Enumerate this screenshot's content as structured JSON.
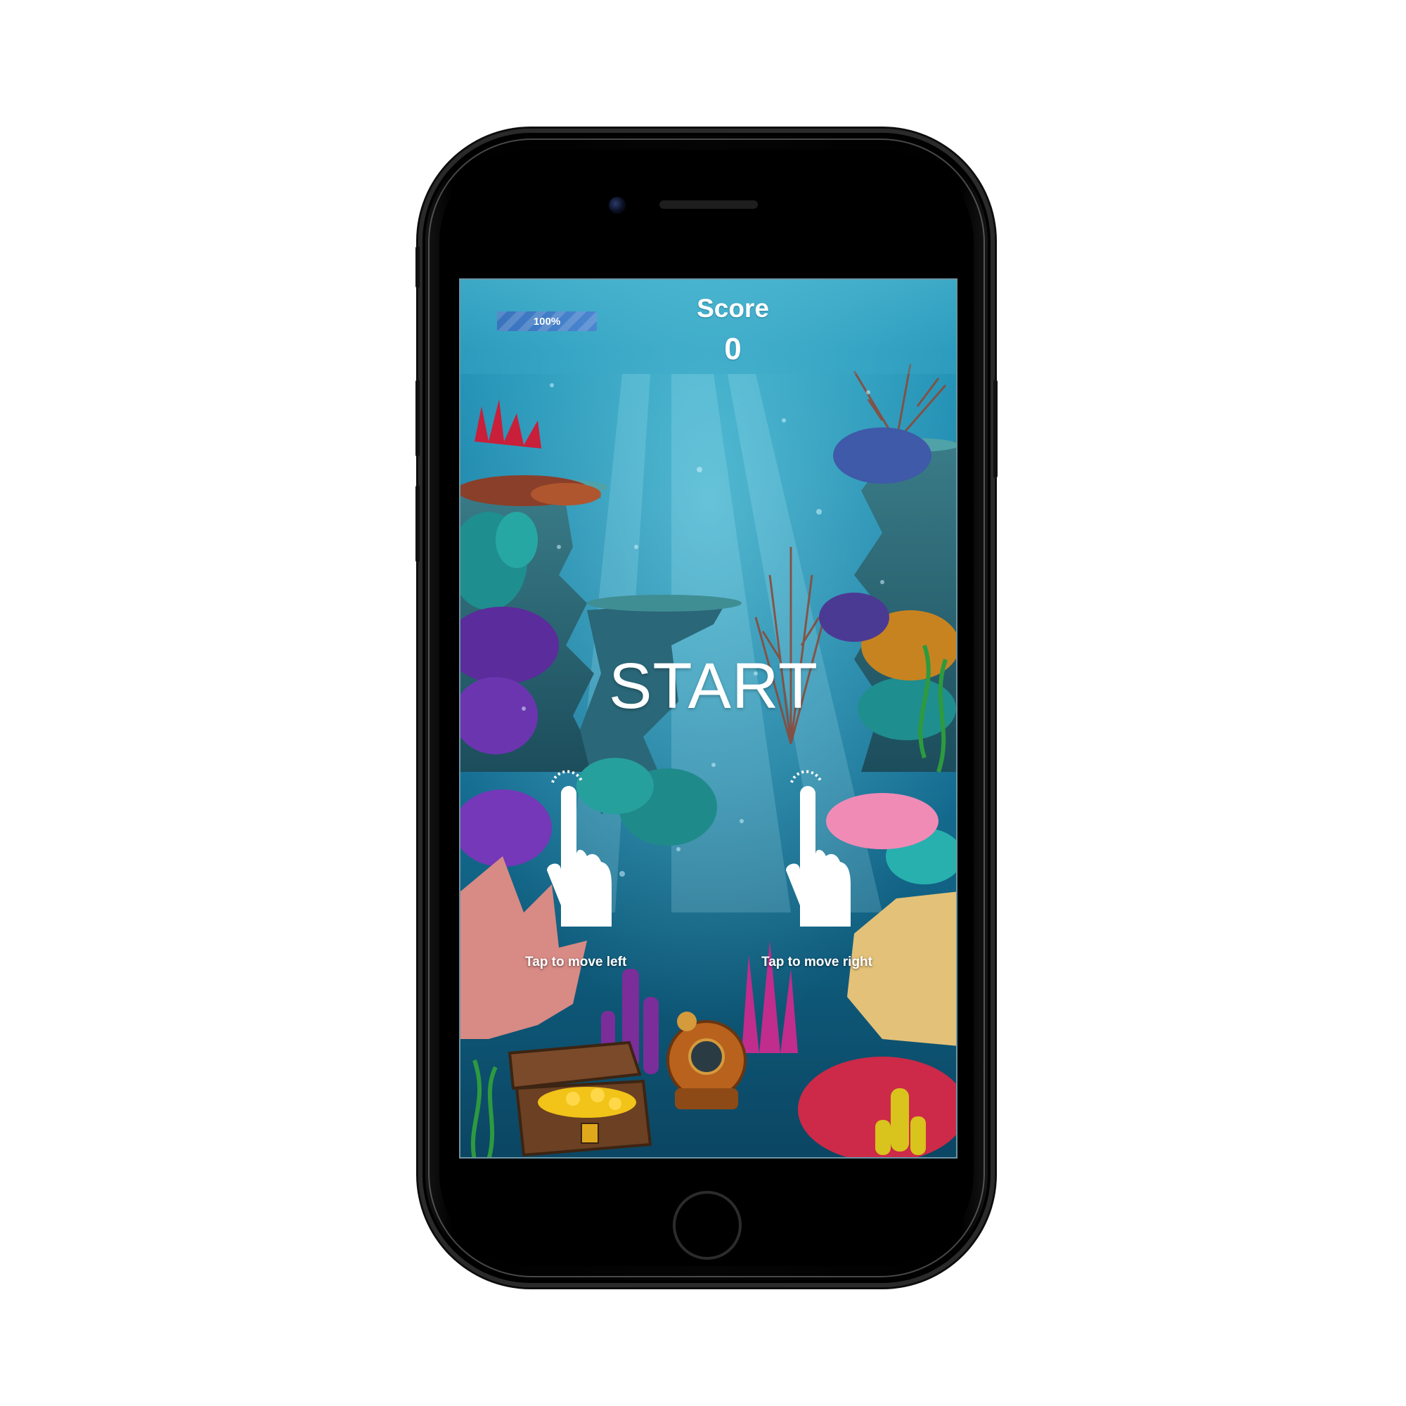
{
  "hud": {
    "progress_label": "100%",
    "progress_value": 100,
    "score_label": "Score",
    "score_value": "0"
  },
  "game": {
    "start_label": "START",
    "hint_left": "Tap to move left",
    "hint_right": "Tap to move right"
  },
  "colors": {
    "water_top": "#3aa6c4",
    "water_bottom": "#0b4663",
    "progress_bar": "#3d79c6",
    "text": "#ffffff",
    "phone_body": "#000000"
  }
}
